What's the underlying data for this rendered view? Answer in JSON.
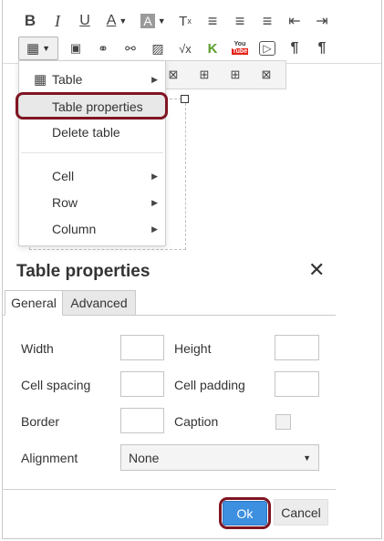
{
  "toolbar": {
    "row1": [
      {
        "name": "bold-icon",
        "glyph": "B"
      },
      {
        "name": "italic-icon",
        "glyph": "I"
      },
      {
        "name": "underline-icon",
        "glyph": "U"
      },
      {
        "name": "text-color-icon",
        "glyph": "A"
      },
      {
        "name": "background-color-icon",
        "glyph": "A"
      },
      {
        "name": "clear-formatting-icon",
        "glyph": "Tx"
      },
      {
        "name": "align-left-icon",
        "glyph": "≡"
      },
      {
        "name": "align-center-icon",
        "glyph": "≡"
      },
      {
        "name": "align-right-icon",
        "glyph": "≡"
      },
      {
        "name": "outdent-icon",
        "glyph": "⇤"
      },
      {
        "name": "indent-icon",
        "glyph": "⇥"
      }
    ],
    "row2": [
      {
        "name": "table-icon",
        "glyph": "▦"
      },
      {
        "name": "media-icon",
        "glyph": "▣"
      },
      {
        "name": "link-icon",
        "glyph": "🔗"
      },
      {
        "name": "unlink-icon",
        "glyph": "⛓"
      },
      {
        "name": "image-icon",
        "glyph": "🖼"
      },
      {
        "name": "equation-icon",
        "glyph": "√x"
      },
      {
        "name": "kaltura-icon",
        "glyph": "K"
      },
      {
        "name": "youtube-icon",
        "glyph": "You"
      },
      {
        "name": "video-icon",
        "glyph": "▷"
      },
      {
        "name": "ltr-paragraph-icon",
        "glyph": "¶"
      },
      {
        "name": "rtl-paragraph-icon",
        "glyph": "¶"
      }
    ]
  },
  "table_menu": {
    "items": [
      {
        "label": "Table",
        "submenu": true,
        "icon": "table-icon"
      },
      {
        "label": "Table properties",
        "submenu": false,
        "highlighted": true
      },
      {
        "label": "Delete table",
        "submenu": false
      },
      {
        "label": "Cell",
        "submenu": true
      },
      {
        "label": "Row",
        "submenu": true
      },
      {
        "label": "Column",
        "submenu": true
      }
    ]
  },
  "table_subtoolbar": [
    {
      "name": "delete-column-icon",
      "glyph": "⊠"
    },
    {
      "name": "insert-row-icon",
      "glyph": "⊞"
    },
    {
      "name": "insert-column-icon",
      "glyph": "⊞"
    },
    {
      "name": "delete-row-icon",
      "glyph": "⊠"
    }
  ],
  "dialog": {
    "title": "Table properties",
    "close": "✕",
    "tabs": [
      "General",
      "Advanced"
    ],
    "fields": {
      "width_label": "Width",
      "height_label": "Height",
      "cell_spacing_label": "Cell spacing",
      "cell_padding_label": "Cell padding",
      "border_label": "Border",
      "caption_label": "Caption",
      "alignment_label": "Alignment",
      "alignment_value": "None"
    },
    "ok_label": "Ok",
    "cancel_label": "Cancel"
  },
  "colors": {
    "highlight_ring": "#7f1522",
    "ok_button": "#3d8fe0"
  }
}
